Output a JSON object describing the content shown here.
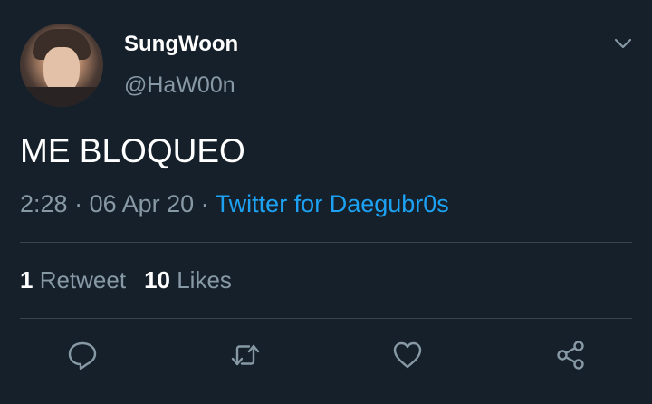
{
  "user": {
    "display_name": "SungWoon",
    "handle": "@HaW00n"
  },
  "tweet": {
    "text": "ME BLOQUEO",
    "time": "2:28",
    "date": "06 Apr 20",
    "separator": " · ",
    "source": "Twitter for Daegubr0s"
  },
  "stats": {
    "retweets_count": "1",
    "retweets_label": " Retweet",
    "likes_count": "10",
    "likes_label": " Likes"
  },
  "icons": {
    "menu": "chevron-down-icon",
    "reply": "reply-icon",
    "retweet": "retweet-icon",
    "like": "heart-icon",
    "share": "share-icon"
  },
  "colors": {
    "background": "#15202b",
    "primary_text": "#ffffff",
    "secondary_text": "#8899a6",
    "link": "#1da1f2",
    "divider": "#38444d"
  }
}
